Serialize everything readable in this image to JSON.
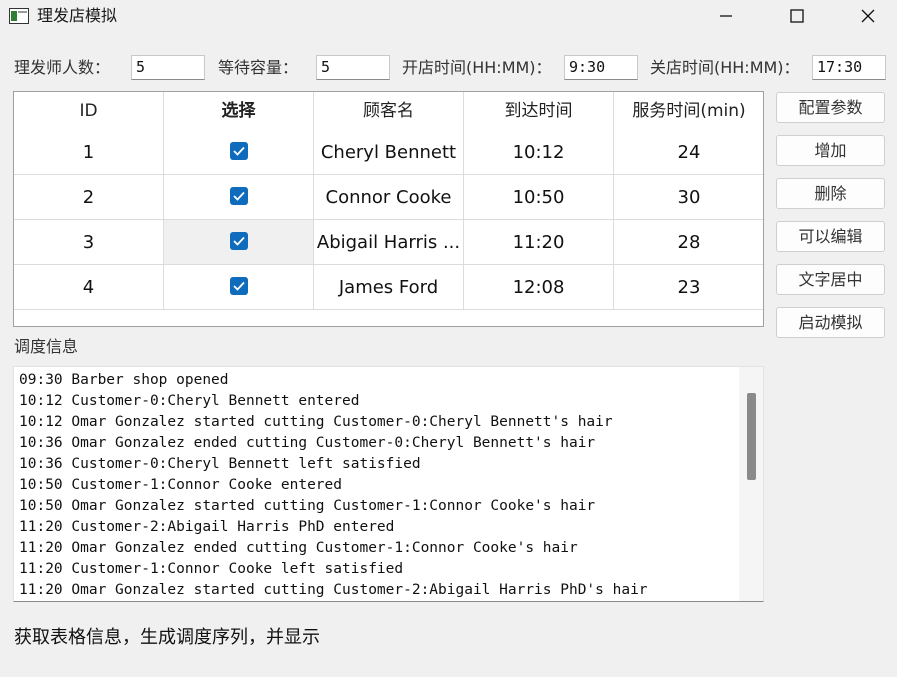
{
  "window": {
    "title": "理发店模拟",
    "icon": "app-window-icon",
    "controls": [
      "minimize-icon",
      "maximize-icon",
      "close-icon"
    ]
  },
  "params": {
    "barbers_label": "理发师人数：",
    "barbers_value": "5",
    "capacity_label": "等待容量：",
    "capacity_value": "5",
    "open_label": "开店时间(HH:MM)：",
    "open_value": "9:30",
    "close_label": "关店时间(HH:MM)：",
    "close_value": "17:30"
  },
  "table": {
    "headers": [
      "ID",
      "选择",
      "顾客名",
      "到达时间",
      "服务时间(min)"
    ],
    "rows": [
      {
        "id": "1",
        "checked": true,
        "name": "Cheryl Bennett",
        "arrival": "10:12",
        "service": "24"
      },
      {
        "id": "2",
        "checked": true,
        "name": "Connor Cooke",
        "arrival": "10:50",
        "service": "30"
      },
      {
        "id": "3",
        "checked": true,
        "name": "Abigail Harris ...",
        "arrival": "11:20",
        "service": "28"
      },
      {
        "id": "4",
        "checked": true,
        "name": "James Ford",
        "arrival": "12:08",
        "service": "23"
      }
    ]
  },
  "buttons": {
    "config": "配置参数",
    "add": "增加",
    "delete": "删除",
    "editable": "可以编辑",
    "center": "文字居中",
    "start": "启动模拟"
  },
  "log": {
    "label": "调度信息",
    "lines": [
      "09:30 Barber shop opened",
      "10:12 Customer-0:Cheryl Bennett entered",
      "10:12 Omar Gonzalez started cutting Customer-0:Cheryl Bennett's hair",
      "10:36 Omar Gonzalez ended cutting Customer-0:Cheryl Bennett's hair",
      "10:36 Customer-0:Cheryl Bennett left satisfied",
      "10:50 Customer-1:Connor Cooke entered",
      "10:50 Omar Gonzalez started cutting Customer-1:Connor Cooke's hair",
      "11:20 Customer-2:Abigail Harris PhD entered",
      "11:20 Omar Gonzalez ended cutting Customer-1:Connor Cooke's hair",
      "11:20 Customer-1:Connor Cooke left satisfied",
      "11:20 Omar Gonzalez started cutting Customer-2:Abigail Harris PhD's hair"
    ]
  },
  "status": "获取表格信息，生成调度序列，并显示",
  "colors": {
    "accent": "#0f6cbd",
    "background": "#f0f0f0"
  }
}
